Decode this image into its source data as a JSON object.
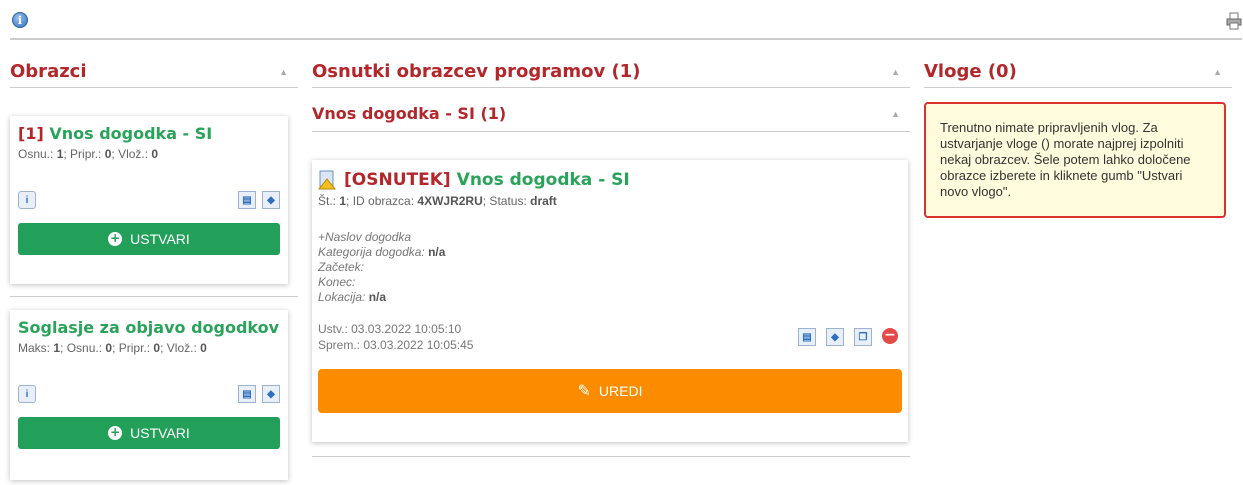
{
  "top": {
    "info_glyph": "i"
  },
  "left": {
    "heading": "Obrazci",
    "cards": [
      {
        "num": "[1]",
        "title": "Vnos dogodka - SI",
        "meta": [
          [
            "Osnu.: ",
            "1"
          ],
          [
            "; Pripr.: ",
            "0"
          ],
          [
            "; Vlož.: ",
            "0"
          ]
        ],
        "button": "USTVARI"
      },
      {
        "num": "",
        "title": "Soglasje za objavo dogodkov",
        "meta": [
          [
            "Maks: ",
            "1"
          ],
          [
            "; Osnu.: ",
            "0"
          ],
          [
            "; Pripr.: ",
            "0"
          ],
          [
            "; Vlož.: ",
            "0"
          ]
        ],
        "button": "USTVARI"
      }
    ]
  },
  "mid": {
    "heading": "Osnutki obrazcev programov (1)",
    "subheading": "Vnos dogodka - SI (1)",
    "draft": {
      "tag": "[OSNUTEK]",
      "title": "Vnos dogodka - SI",
      "meta_st_label": "Št.: ",
      "meta_st": "1",
      "meta_id_label": "; ID obrazca: ",
      "meta_id": "4XWJR2RU",
      "meta_status_label": "; Status: ",
      "meta_status": "draft",
      "field_naslov": "+Naslov dogodka",
      "field_kat_label": "Kategorija dogodka: ",
      "field_kat_value": "n/a",
      "field_zacetek": "Začetek:",
      "field_konec": "Konec:",
      "field_lok_label": "Lokacija: ",
      "field_lok_value": "n/a",
      "created": "Ustv.: 03.03.2022 10:05:10",
      "modified": "Sprem.: 03.03.2022 10:05:45",
      "button": "UREDI"
    }
  },
  "right": {
    "heading": "Vloge (0)",
    "notice": "Trenutno nimate pripravljenih vlog. Za ustvarjanje vloge () morate najprej izpolniti nekaj obrazcev. Šele potem lahko določene obrazce izberete in kliknete gumb \"Ustvari novo vlogo\"."
  },
  "colors": {
    "accent_red": "#b3262a",
    "green": "#22a05a",
    "orange": "#fb8c00"
  }
}
